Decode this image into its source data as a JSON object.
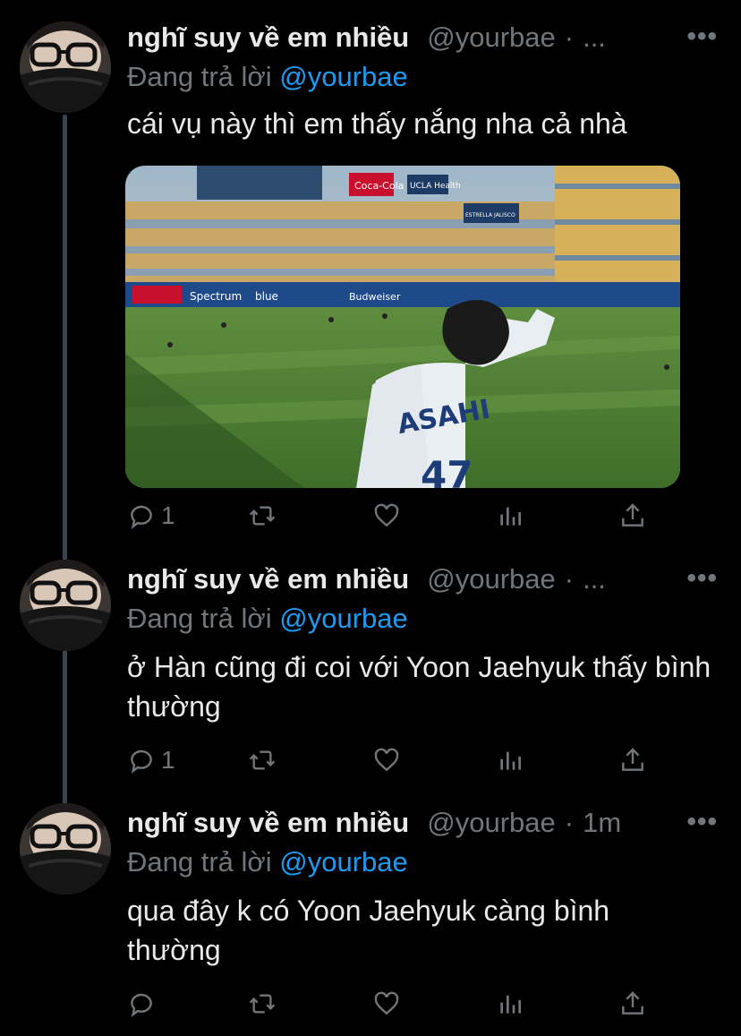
{
  "tweets": [
    {
      "name": "nghĩ suy về em nhiều",
      "handle": "@yourbae",
      "time": "...",
      "reply_prefix": "Đang trả lời",
      "reply_to": "@yourbae",
      "text": "cái vụ này thì em thấy nắng nha cả nhà",
      "has_media": true,
      "media": {
        "jersey_name": "ASAHI",
        "jersey_number": "47",
        "signs": [
          "Coca-Cola",
          "UCLA Health",
          "ESTRELLA JALISCO",
          "Spectrum",
          "blue",
          "Budweiser"
        ]
      },
      "replies": "1",
      "retweets": "",
      "likes": ""
    },
    {
      "name": "nghĩ suy về em nhiều",
      "handle": "@yourbae",
      "time": "...",
      "reply_prefix": "Đang trả lời",
      "reply_to": "@yourbae",
      "text": "ở Hàn cũng đi coi với Yoon Jaehyuk thấy bình thường",
      "has_media": false,
      "replies": "1",
      "retweets": "",
      "likes": ""
    },
    {
      "name": "nghĩ suy về em nhiều",
      "handle": "@yourbae",
      "time": "1m",
      "reply_prefix": "Đang trả lời",
      "reply_to": "@yourbae",
      "text": "qua đây k có Yoon Jaehyuk càng bình thường",
      "has_media": false,
      "replies": "",
      "retweets": "",
      "likes": ""
    }
  ],
  "more_label": "•••",
  "separator": "·",
  "icons": [
    "reply-icon",
    "retweet-icon",
    "like-icon",
    "analytics-icon",
    "share-icon"
  ],
  "colors": {
    "background": "#000000",
    "text": "#e7e9ea",
    "muted": "#71767b",
    "link": "#1d9bf0",
    "thread": "#38444d"
  }
}
